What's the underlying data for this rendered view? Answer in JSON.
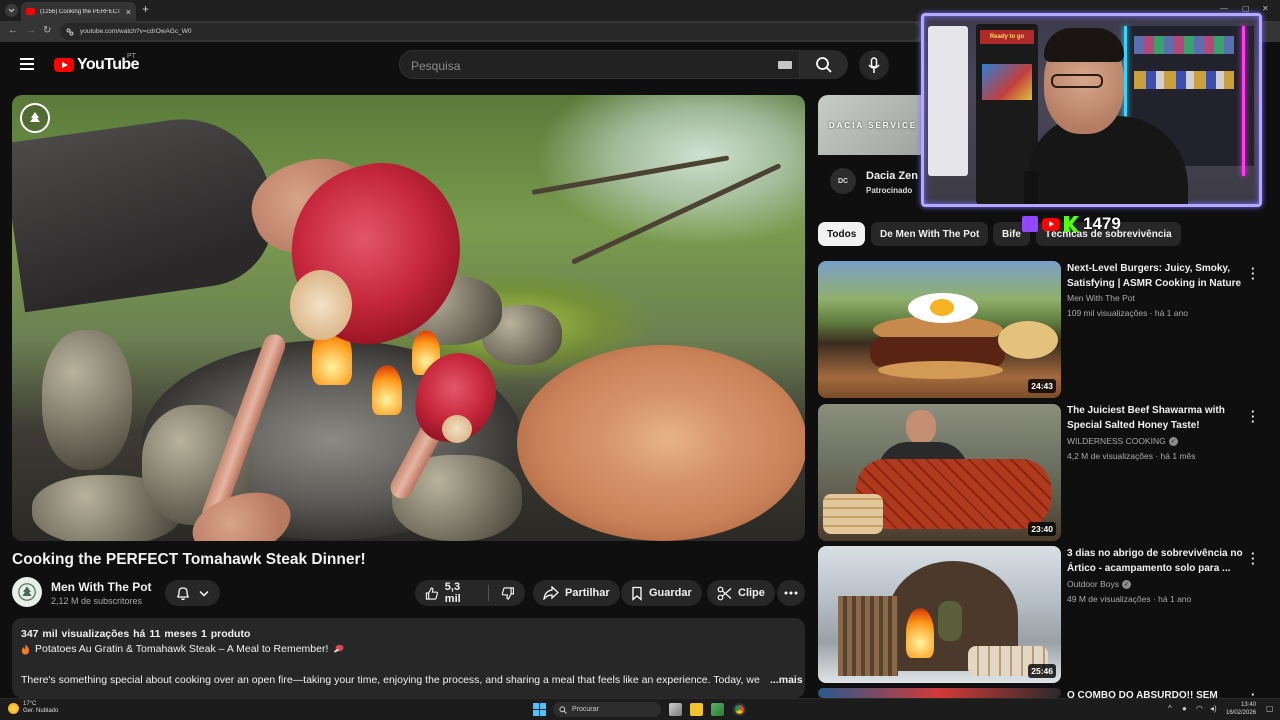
{
  "browser": {
    "tab_title": "(1256) Cooking the PERFECT To",
    "tab_close": "×",
    "new_tab": "+",
    "url": "youtube.com/watch?v=cdrOwAGc_W0"
  },
  "header": {
    "logo": "YouTube",
    "region": "PT",
    "search_placeholder": "Pesquisa"
  },
  "video": {
    "title": "Cooking the PERFECT Tomahawk Steak Dinner!",
    "channel_name": "Men With The Pot",
    "subscribers": "2,12 M de subscritores",
    "likes": "5,3 mil",
    "share_label": "Partilhar",
    "save_label": "Guardar",
    "clip_label": "Clipe"
  },
  "description": {
    "meta": "347 mil visualizações  há 11 meses  1 produto",
    "line1": "Potatoes Au Gratin & Tomahawk Steak – A Meal to Remember! ",
    "line2": "There's something special about cooking over an open fire—taking your time, enjoying the process, and sharing a meal that feels like an experience. Today, we",
    "more": "...mais"
  },
  "ad": {
    "image_text": "DACIA SERVICE",
    "logo_text": "DC",
    "title": "Dacia Zen",
    "sponsored": "Patrocinado"
  },
  "chips": [
    "Todos",
    "De Men With The Pot",
    "Bife",
    "Técnicas de sobrevivência"
  ],
  "recommendations": [
    {
      "title": "Next-Level Burgers: Juicy, Smoky, Satisfying | ASMR Cooking in Nature",
      "channel": "Men With The Pot",
      "verified": false,
      "stats": "109 mil visualizações  · há 1 ano",
      "duration": "24:43"
    },
    {
      "title": "The Juiciest Beef Shawarma with Special Salted Honey Taste!",
      "channel": "WILDERNESS COOKING",
      "verified": true,
      "stats": "4,2 M de visualizações  · há 1 mês",
      "duration": "23:40"
    },
    {
      "title": "3 dias no abrigo de sobrevivência no Ártico - acampamento solo para ...",
      "channel": "Outdoor Boys",
      "verified": true,
      "stats": "49 M de visualizações  · há 1 ano",
      "duration": "25:46"
    },
    {
      "title": "O COMBO DO ABSURDO!! SEM",
      "channel": "",
      "verified": false,
      "stats": "",
      "duration": ""
    }
  ],
  "overlay": {
    "viewer_count": "1479",
    "arcade_marquee": "Ready to go"
  },
  "taskbar": {
    "temperature": "17°C",
    "weather": "Ger. Nublado",
    "search": "Procurar",
    "time": "13:40",
    "date": "16/02/2026"
  },
  "colors": {
    "youtube_red": "#ff0000",
    "twitch_purple": "#9146ff",
    "kick_green": "#53fc18",
    "overlay_border": "#b6a7ff"
  }
}
